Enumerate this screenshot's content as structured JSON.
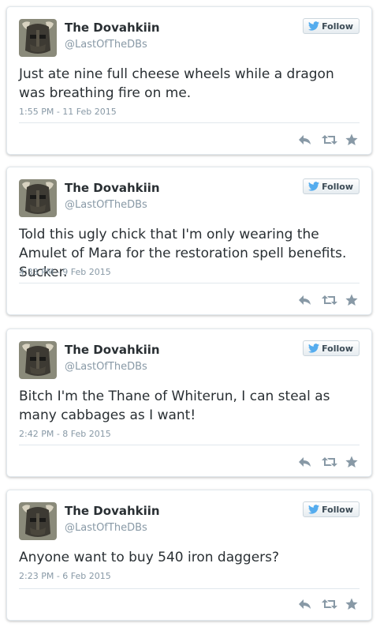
{
  "follow_label": "Follow",
  "colors": {
    "twitter_blue": "#55acee",
    "action_gray": "#8899a6"
  },
  "tweets": [
    {
      "name": "The Dovahkiin",
      "handle": "@LastOfTheDBs",
      "text": "Just ate nine full cheese wheels while a dragon was breathing fire on me.",
      "time": "1:55 PM - 11 Feb 2015"
    },
    {
      "name": "The Dovahkiin",
      "handle": "@LastOfTheDBs",
      "text": "Told this ugly chick that I'm only wearing the Amulet of Mara for the restoration spell benefits. Sucker.",
      "time": "4:33 PM - 9 Feb 2015"
    },
    {
      "name": "The Dovahkiin",
      "handle": "@LastOfTheDBs",
      "text": "Bitch I'm the Thane of Whiterun, I can steal as many cabbages as I want!",
      "time": "2:42 PM - 8 Feb 2015"
    },
    {
      "name": "The Dovahkiin",
      "handle": "@LastOfTheDBs",
      "text": "Anyone want to buy 540 iron daggers?",
      "time": "2:23 PM - 6 Feb 2015"
    }
  ]
}
